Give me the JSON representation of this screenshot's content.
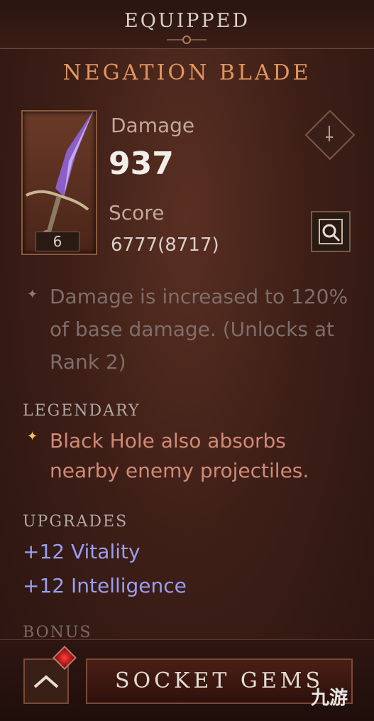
{
  "header": {
    "status": "EQUIPPED"
  },
  "item": {
    "name": "NEGATION BLADE",
    "level": "6",
    "damage_label": "Damage",
    "damage_value": "937",
    "score_label": "Score",
    "score_value": "6777(8717)"
  },
  "aspect": {
    "text": "Damage is increased to 120% of base damage. (Unlocks at Rank 2)"
  },
  "legendary": {
    "heading": "LEGENDARY",
    "text": "Black Hole also absorbs nearby enemy projectiles."
  },
  "upgrades": {
    "heading": "UPGRADES",
    "items": [
      "+12 Vitality",
      "+12 Intelligence"
    ]
  },
  "bonus": {
    "heading": "BONUS"
  },
  "footer": {
    "socket_label": "SOCKET GEMS"
  },
  "watermark": {
    "text": "九游"
  },
  "icons": {
    "compare": "sword-icon",
    "inspect": "magnifier-icon",
    "collapse": "chevron-up-icon",
    "gem": "ruby-gem-icon",
    "aspect_bullet": "diamond-bullet-icon",
    "legendary_bullet": "star-bullet-icon"
  },
  "colors": {
    "title": "#e09560",
    "legendary": "#d08a76",
    "upgrade": "#9a9ef0",
    "aspect": "#7e6e6a"
  }
}
